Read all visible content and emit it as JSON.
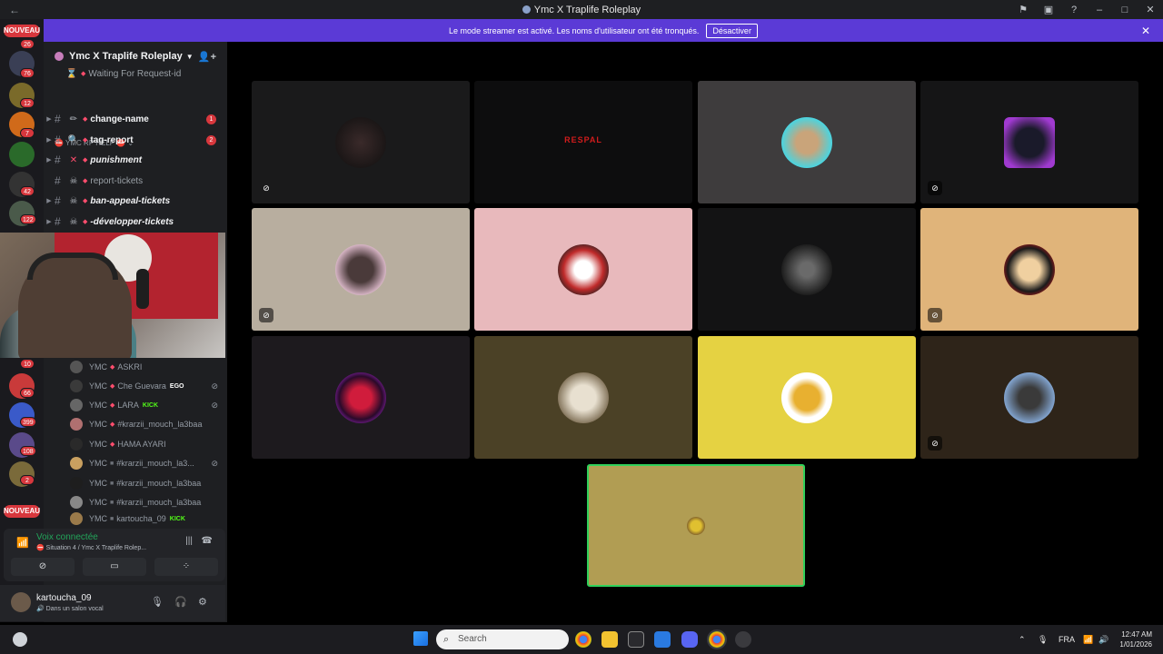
{
  "window": {
    "title": "Ymc X Traplife Roleplay"
  },
  "streamer_bar": {
    "message": "Le mode streamer est activé. Les noms d'utilisateur ont été tronqués.",
    "button": "Désactiver"
  },
  "rail": {
    "new_label": "NOUVEAU",
    "counts": [
      "26",
      "76",
      "12",
      "7",
      "42",
      "122",
      "10",
      "66",
      "399",
      "108",
      "2"
    ]
  },
  "server": {
    "name": "Ymc X Traplife Roleplay"
  },
  "channels": {
    "waiting": "Waiting For Request-id",
    "category": "YMC RP HELP",
    "items": [
      {
        "name": "change-name",
        "count": "1"
      },
      {
        "name": "tag-report",
        "count": "2"
      },
      {
        "name": "punishment"
      },
      {
        "name": "report-tickets"
      },
      {
        "name": "ban-appeal-tickets"
      },
      {
        "name": "-développer-tickets"
      }
    ]
  },
  "members": [
    {
      "prefix": "YMC",
      "name": "ASKRI",
      "badge": ""
    },
    {
      "prefix": "YMC",
      "name": "Che Guevara",
      "badge": "EGO"
    },
    {
      "prefix": "YMC",
      "name": "LARA",
      "badge": "KICK"
    },
    {
      "prefix": "YMC",
      "name": "#krarzii_mouch_la3baa",
      "badge": ""
    },
    {
      "prefix": "YMC",
      "name": "HAMA AYARI",
      "badge": ""
    },
    {
      "prefix": "YMC",
      "name": "#krarzii_mouch_la3...",
      "badge": ""
    },
    {
      "prefix": "YMC",
      "name": "#krarzii_mouch_la3baa",
      "badge": ""
    },
    {
      "prefix": "YMC",
      "name": "#krarzii_mouch_la3baa",
      "badge": ""
    },
    {
      "prefix": "YMC",
      "name": "kartoucha_09",
      "badge": "KICK"
    }
  ],
  "voice": {
    "status": "Voix connectée",
    "channel": "Situation 4 / Ymc X Traplife Rolep..."
  },
  "user": {
    "name": "kartoucha_09",
    "status": "Dans un salon vocal"
  },
  "tiles": [
    {
      "text": ""
    },
    {
      "text": "RESPAL"
    },
    {
      "text": ""
    },
    {
      "text": ""
    },
    {
      "text": ""
    },
    {
      "text": ""
    },
    {
      "text": ""
    },
    {
      "text": ""
    },
    {
      "text": ""
    },
    {
      "text": ""
    },
    {
      "text": ""
    },
    {
      "text": ""
    },
    {
      "text": ""
    }
  ],
  "taskbar": {
    "search_placeholder": "Search",
    "lang": "FRA",
    "time": "12:47 AM",
    "date": "1/01/2026"
  },
  "colors": {
    "accent": "#5b3ad6",
    "danger": "#d8373d",
    "online": "#23a55a"
  }
}
